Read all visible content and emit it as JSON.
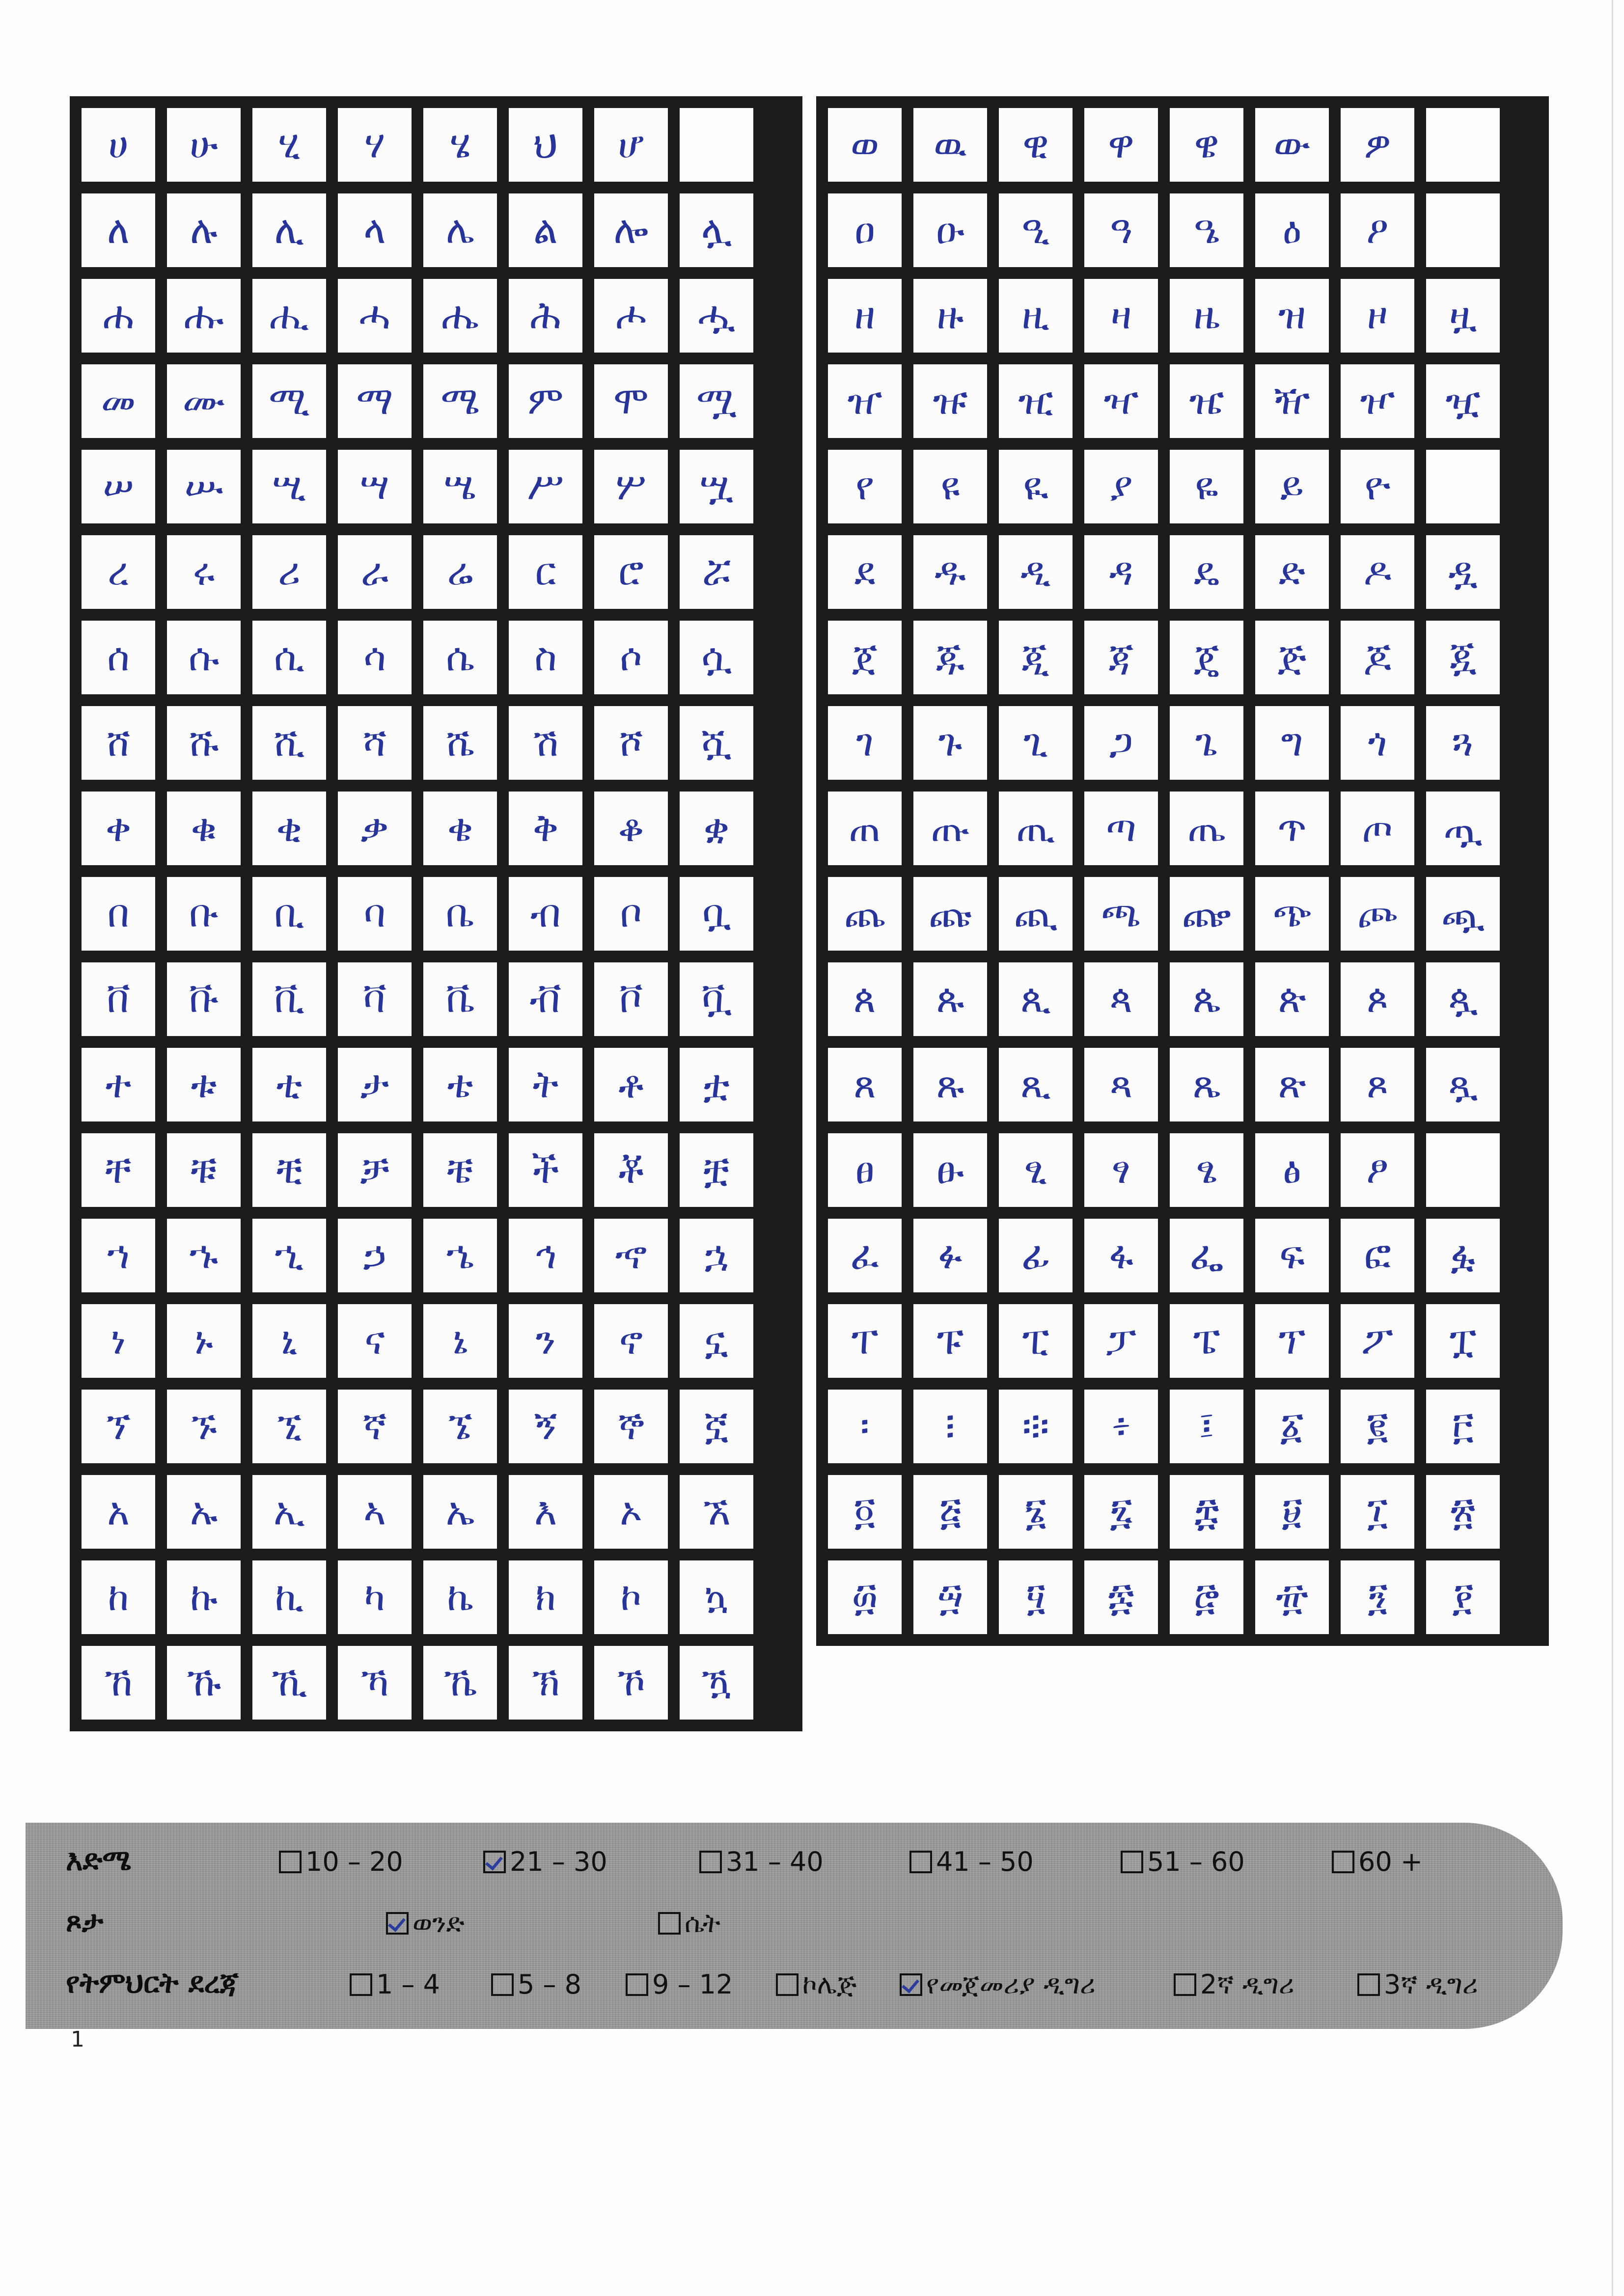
{
  "left_grid": [
    [
      "ሀ",
      "ሁ",
      "ሂ",
      "ሃ",
      "ሄ",
      "ህ",
      "ሆ",
      ""
    ],
    [
      "ለ",
      "ሉ",
      "ሊ",
      "ላ",
      "ሌ",
      "ል",
      "ሎ",
      "ሏ"
    ],
    [
      "ሐ",
      "ሑ",
      "ሒ",
      "ሓ",
      "ሔ",
      "ሕ",
      "ሖ",
      "ሗ"
    ],
    [
      "መ",
      "ሙ",
      "ሚ",
      "ማ",
      "ሜ",
      "ም",
      "ሞ",
      "ሟ"
    ],
    [
      "ሠ",
      "ሡ",
      "ሢ",
      "ሣ",
      "ሤ",
      "ሥ",
      "ሦ",
      "ሧ"
    ],
    [
      "ረ",
      "ሩ",
      "ሪ",
      "ራ",
      "ሬ",
      "ር",
      "ሮ",
      "ሯ"
    ],
    [
      "ሰ",
      "ሱ",
      "ሲ",
      "ሳ",
      "ሴ",
      "ስ",
      "ሶ",
      "ሷ"
    ],
    [
      "ሸ",
      "ሹ",
      "ሺ",
      "ሻ",
      "ሼ",
      "ሽ",
      "ሾ",
      "ሿ"
    ],
    [
      "ቀ",
      "ቁ",
      "ቂ",
      "ቃ",
      "ቄ",
      "ቅ",
      "ቆ",
      "ቋ"
    ],
    [
      "በ",
      "ቡ",
      "ቢ",
      "ባ",
      "ቤ",
      "ብ",
      "ቦ",
      "ቧ"
    ],
    [
      "ቨ",
      "ቩ",
      "ቪ",
      "ቫ",
      "ቬ",
      "ቭ",
      "ቮ",
      "ቯ"
    ],
    [
      "ተ",
      "ቱ",
      "ቲ",
      "ታ",
      "ቴ",
      "ት",
      "ቶ",
      "ቷ"
    ],
    [
      "ቸ",
      "ቹ",
      "ቺ",
      "ቻ",
      "ቼ",
      "ች",
      "ቾ",
      "ቿ"
    ],
    [
      "ኀ",
      "ኁ",
      "ኂ",
      "ኃ",
      "ኄ",
      "ኅ",
      "ኆ",
      "ኋ"
    ],
    [
      "ነ",
      "ኑ",
      "ኒ",
      "ና",
      "ኔ",
      "ን",
      "ኖ",
      "ኗ"
    ],
    [
      "ኘ",
      "ኙ",
      "ኚ",
      "ኛ",
      "ኜ",
      "ኝ",
      "ኞ",
      "ኟ"
    ],
    [
      "አ",
      "ኡ",
      "ኢ",
      "ኣ",
      "ኤ",
      "እ",
      "ኦ",
      "ኧ"
    ],
    [
      "ከ",
      "ኩ",
      "ኪ",
      "ካ",
      "ኬ",
      "ክ",
      "ኮ",
      "ኳ"
    ],
    [
      "ኸ",
      "ኹ",
      "ኺ",
      "ኻ",
      "ኼ",
      "ኽ",
      "ኾ",
      "ዃ"
    ]
  ],
  "right_grid": [
    [
      "ወ",
      "ዉ",
      "ዊ",
      "ዋ",
      "ዌ",
      "ው",
      "ዎ",
      ""
    ],
    [
      "ዐ",
      "ዑ",
      "ዒ",
      "ዓ",
      "ዔ",
      "ዕ",
      "ዖ",
      ""
    ],
    [
      "ዘ",
      "ዙ",
      "ዚ",
      "ዛ",
      "ዜ",
      "ዝ",
      "ዞ",
      "ዟ"
    ],
    [
      "ዠ",
      "ዡ",
      "ዢ",
      "ዣ",
      "ዤ",
      "ዥ",
      "ዦ",
      "ዧ"
    ],
    [
      "የ",
      "ዩ",
      "ዪ",
      "ያ",
      "ዬ",
      "ይ",
      "ዮ",
      ""
    ],
    [
      "ደ",
      "ዱ",
      "ዲ",
      "ዳ",
      "ዴ",
      "ድ",
      "ዶ",
      "ዷ"
    ],
    [
      "ጀ",
      "ጁ",
      "ጂ",
      "ጃ",
      "ጄ",
      "ጅ",
      "ጆ",
      "ጇ"
    ],
    [
      "ገ",
      "ጉ",
      "ጊ",
      "ጋ",
      "ጌ",
      "ግ",
      "ጎ",
      "ጓ"
    ],
    [
      "ጠ",
      "ጡ",
      "ጢ",
      "ጣ",
      "ጤ",
      "ጥ",
      "ጦ",
      "ጧ"
    ],
    [
      "ጨ",
      "ጩ",
      "ጪ",
      "ጫ",
      "ጬ",
      "ጭ",
      "ጮ",
      "ጯ"
    ],
    [
      "ጰ",
      "ጱ",
      "ጲ",
      "ጳ",
      "ጴ",
      "ጵ",
      "ጶ",
      "ጷ"
    ],
    [
      "ጸ",
      "ጹ",
      "ጺ",
      "ጻ",
      "ጼ",
      "ጽ",
      "ጾ",
      "ጿ"
    ],
    [
      "ፀ",
      "ፁ",
      "ፂ",
      "ፃ",
      "ፄ",
      "ፅ",
      "ፆ",
      ""
    ],
    [
      "ፈ",
      "ፉ",
      "ፊ",
      "ፋ",
      "ፌ",
      "ፍ",
      "ፎ",
      "ፏ"
    ],
    [
      "ፐ",
      "ፑ",
      "ፒ",
      "ፓ",
      "ፔ",
      "ፕ",
      "ፖ",
      "ፗ"
    ],
    [
      "፡",
      "፧",
      "፨",
      "፥",
      "፤",
      "፩",
      "፪",
      "፫"
    ],
    [
      "፬",
      "፭",
      "፮",
      "፯",
      "፰",
      "፱",
      "፲",
      "፳"
    ],
    [
      "፴",
      "፵",
      "፶",
      "፷",
      "፸",
      "፹",
      "፺",
      "፻"
    ]
  ],
  "demographics": {
    "age": {
      "label": "እድሜ",
      "options": [
        {
          "text": "10 – 20",
          "checked": false
        },
        {
          "text": "21 – 30",
          "checked": true
        },
        {
          "text": "31 – 40",
          "checked": false
        },
        {
          "text": "41 – 50",
          "checked": false
        },
        {
          "text": "51 – 60",
          "checked": false
        },
        {
          "text": "60 +",
          "checked": false
        }
      ]
    },
    "sex": {
      "label": "ጾታ",
      "options": [
        {
          "text": "ወንድ",
          "checked": true
        },
        {
          "text": "ሴት",
          "checked": false
        }
      ]
    },
    "education": {
      "label": "የትምህርት ደረጃ",
      "options": [
        {
          "text": "1 – 4",
          "checked": false
        },
        {
          "text": "5 – 8",
          "checked": false
        },
        {
          "text": "9 – 12",
          "checked": false
        },
        {
          "text": "ኮሌጅ",
          "checked": false
        },
        {
          "text": "የመጀመሪያ ዲግሪ",
          "checked": true
        },
        {
          "text": "2ኛ ዲግሪ",
          "checked": false
        },
        {
          "text": "3ኛ ዲግሪ",
          "checked": false
        }
      ]
    }
  },
  "page_number": "1",
  "colors": {
    "ink": "#27359a",
    "grid": "#1c1c1c",
    "band": "#9a9a9a"
  }
}
